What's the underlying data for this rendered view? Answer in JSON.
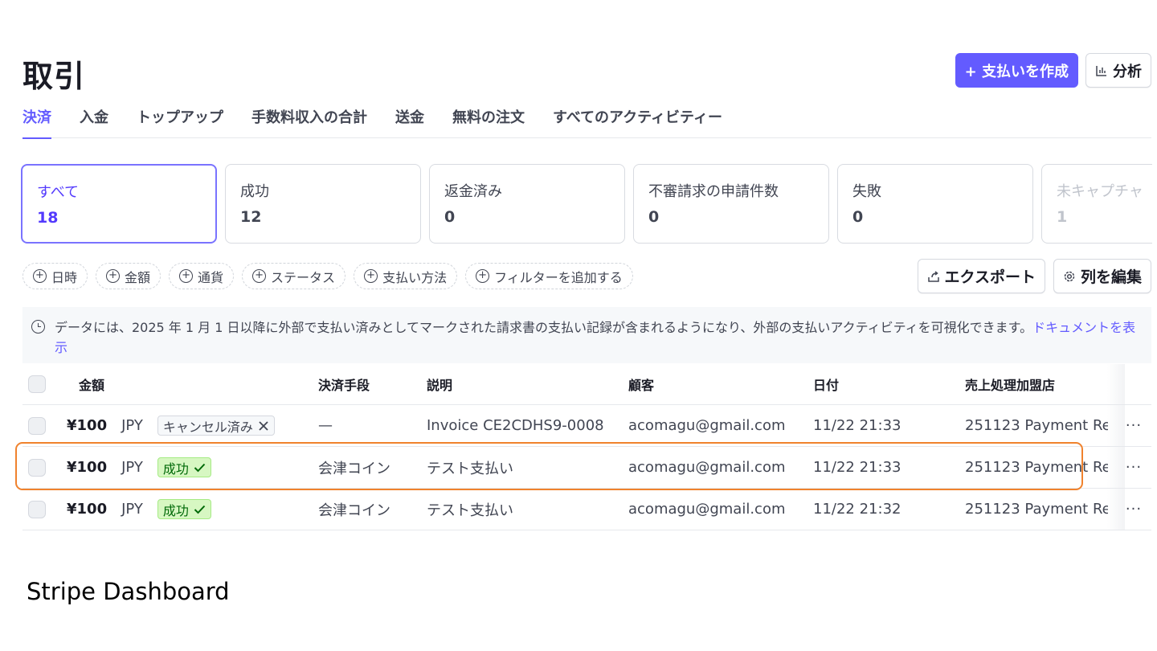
{
  "page_title": "取引",
  "top_actions": {
    "create_label": "+ 支払いを作成",
    "analysis_icon": "bar-chart-icon",
    "analysis_label": "分析"
  },
  "tabs": [
    {
      "label": "決済",
      "active": true
    },
    {
      "label": "入金"
    },
    {
      "label": "トップアップ"
    },
    {
      "label": "手数料収入の合計"
    },
    {
      "label": "送金"
    },
    {
      "label": "無料の注文"
    },
    {
      "label": "すべてのアクティビティー"
    }
  ],
  "status_cards": [
    {
      "label": "すべて",
      "count": "18",
      "active": true
    },
    {
      "label": "成功",
      "count": "12"
    },
    {
      "label": "返金済み",
      "count": "0"
    },
    {
      "label": "不審請求の申請件数",
      "count": "0"
    },
    {
      "label": "失敗",
      "count": "0"
    },
    {
      "label": "未キャプチャ",
      "count": "1",
      "faded": true
    }
  ],
  "filters": [
    "日時",
    "金額",
    "通貨",
    "ステータス",
    "支払い方法",
    "フィルターを追加する"
  ],
  "filter_actions": {
    "export_label": "エクスポート",
    "edit_columns_label": "列を編集"
  },
  "notice": {
    "text": "データには、2025 年 1 月 1 日以降に外部で支払い済みとしてマークされた請求書の支払い記録が含まれるようになり、外部の支払いアクティビティを可視化できます。",
    "link": "ドキュメントを表示"
  },
  "table": {
    "headers": {
      "amount": "金額",
      "method": "決済手段",
      "description": "説明",
      "customer": "顧客",
      "date": "日付",
      "merchant": "売上処理加盟店"
    },
    "rows": [
      {
        "amount": "¥100",
        "currency": "JPY",
        "status": "キャンセル済み",
        "status_type": "cancel",
        "method": "—",
        "description": "Invoice CE2CDHS9-0008",
        "customer": "acomagu@gmail.com",
        "date": "11/22 21:33",
        "merchant": "251123 Payment Re"
      },
      {
        "amount": "¥100",
        "currency": "JPY",
        "status": "成功",
        "status_type": "success",
        "method": "会津コイン",
        "description": "テスト支払い",
        "customer": "acomagu@gmail.com",
        "date": "11/22 21:33",
        "merchant": "251123 Payment Re"
      },
      {
        "amount": "¥100",
        "currency": "JPY",
        "status": "成功",
        "status_type": "success",
        "method": "会津コイン",
        "description": "テスト支払い",
        "customer": "acomagu@gmail.com",
        "date": "11/22 21:32",
        "merchant": "251123 Payment Re"
      }
    ],
    "more_label": "···"
  },
  "colors": {
    "accent": "#635bff",
    "success_bg": "#d7f7c2",
    "success_text": "#006908",
    "highlight": "#f0822d"
  },
  "caption": "Stripe Dashboard"
}
